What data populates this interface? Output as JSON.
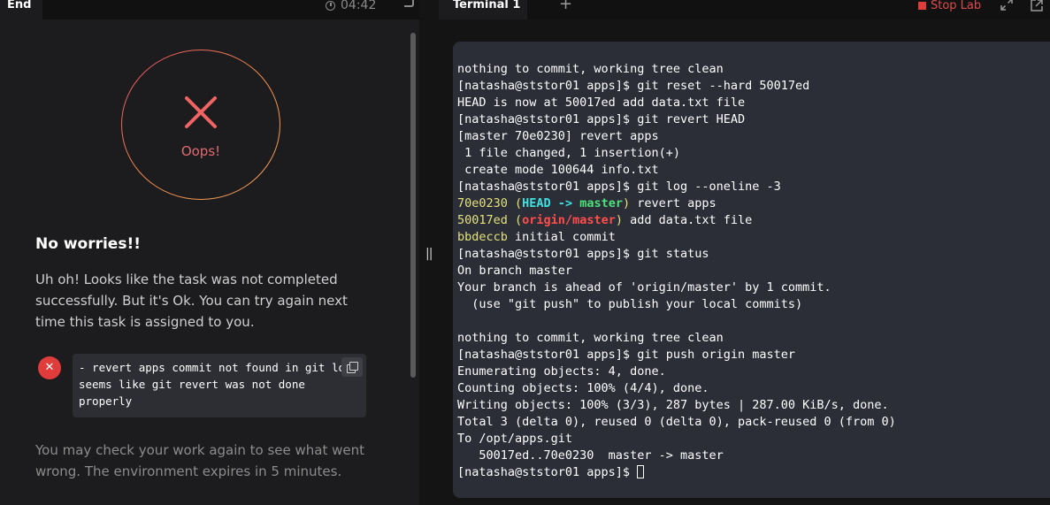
{
  "left_panel": {
    "tab_label": "End",
    "timer": "04:42",
    "result_label": "Oops!",
    "heading": "No worries!!",
    "message": "Uh oh! Looks like the task was not completed successfully. But it's Ok. You can try again next time this task is assigned to you.",
    "error_text": "- revert apps commit not found in git log\nseems like git revert was not done\nproperly",
    "footer": "You may check your work again to see what went wrong. The environment expires in 5 minutes."
  },
  "divider": {
    "handle": "||"
  },
  "right_panel": {
    "tab_label": "Terminal 1",
    "add_tab": "+",
    "stop_lab": "Stop Lab"
  },
  "terminal": {
    "lines": [
      "nothing to commit, working tree clean",
      "[natasha@ststor01 apps]$ git reset --hard 50017ed",
      "HEAD is now at 50017ed add data.txt file",
      "[natasha@ststor01 apps]$ git revert HEAD",
      "[master 70e0230] revert apps",
      " 1 file changed, 1 insertion(+)",
      " create mode 100644 info.txt",
      "[natasha@ststor01 apps]$ git log --oneline -3",
      "",
      "",
      "",
      "[natasha@ststor01 apps]$ git status",
      "On branch master",
      "Your branch is ahead of 'origin/master' by 1 commit.",
      "  (use \"git push\" to publish your local commits)",
      "",
      "nothing to commit, working tree clean",
      "[natasha@ststor01 apps]$ git push origin master",
      "Enumerating objects: 4, done.",
      "Counting objects: 100% (4/4), done.",
      "Writing objects: 100% (3/3), 287 bytes | 287.00 KiB/s, done.",
      "Total 3 (delta 0), reused 0 (delta 0), pack-reused 0 (from 0)",
      "To /opt/apps.git",
      "   50017ed..70e0230  master -> master",
      "[natasha@ststor01 apps]$ "
    ],
    "log": [
      {
        "hash": "70e0230",
        "open": " (",
        "head": "HEAD -> ",
        "branch": "master",
        "close": ")",
        "msg": " revert apps"
      },
      {
        "hash": "50017ed",
        "open": " (",
        "origin": "origin/master",
        "close": ")",
        "msg": " add data.txt file"
      },
      {
        "hash": "bbdeccb",
        "msg": " initial commit"
      }
    ]
  },
  "colors": {
    "commit_hash": "#e3e37a",
    "head_ref": "#3ee0e0",
    "branch_ref": "#4ee07a",
    "remote_ref": "#ff4e4e",
    "error_red": "#e03c3c"
  }
}
